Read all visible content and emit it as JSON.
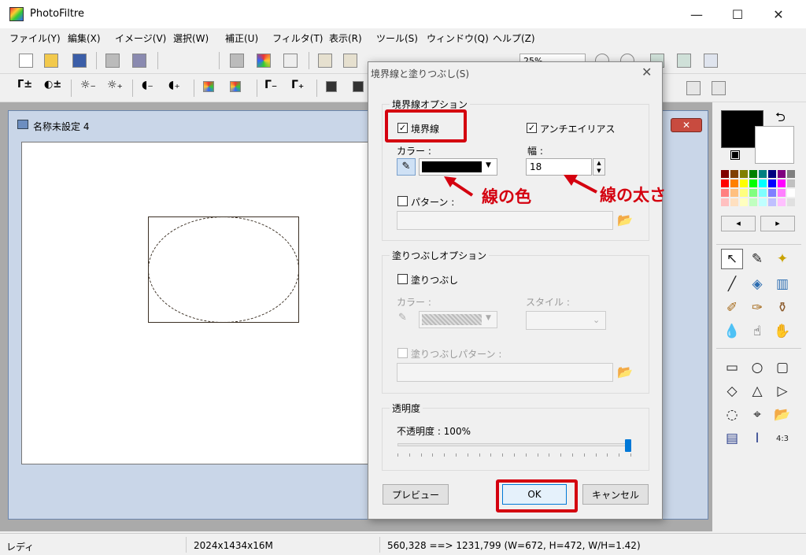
{
  "app": {
    "title": "PhotoFiltre"
  },
  "window_controls": {
    "minimize": "—",
    "maximize": "☐",
    "close": "✕"
  },
  "menu": [
    "ファイル(Y)",
    "編集(X)",
    "イメージ(V)",
    "選択(W)",
    "補正(U)",
    "フィルタ(T)",
    "表示(R)",
    "ツール(S)",
    "ウィンドウ(Q)",
    "ヘルプ(Z)"
  ],
  "toolbar": {
    "zoom_value": "25%"
  },
  "document": {
    "title": "名称未設定 4"
  },
  "dialog": {
    "title": "境界線と塗りつぶし(S)",
    "close": "✕",
    "border_group": {
      "label": "境界線オプション",
      "border_checkbox_label": "境界線",
      "border_checked": true,
      "antialias_label": "アンチエイリアス",
      "antialias_checked": true,
      "color_label": "カラー :",
      "color_value": "#000000",
      "width_label": "幅 :",
      "width_value": "18",
      "pattern_label": "パターン :",
      "pattern_checked": false
    },
    "fill_group": {
      "label": "塗りつぶしオプション",
      "fill_label": "塗りつぶし",
      "fill_checked": false,
      "color_label": "カラー :",
      "style_label": "スタイル :",
      "pattern_label": "塗りつぶしパターン :"
    },
    "opacity_group": {
      "label": "透明度",
      "opacity_label": "不透明度 : 100%",
      "opacity_fraction": 1.0
    },
    "buttons": {
      "preview": "プレビュー",
      "ok": "OK",
      "cancel": "キャンセル"
    }
  },
  "annotations": {
    "line_color": "線の色",
    "line_width": "線の太さ"
  },
  "status": {
    "mode": "レディ",
    "size": "2024x1434x16M",
    "coords": "560,328 ==> 1231,799 (W=672, H=472, W/H=1.42)"
  },
  "palette_colors": [
    "#800000",
    "#804000",
    "#808000",
    "#008000",
    "#008080",
    "#000080",
    "#800080",
    "#808080",
    "#ff0000",
    "#ff8000",
    "#ffff00",
    "#00ff00",
    "#00ffff",
    "#0000ff",
    "#ff00ff",
    "#c0c0c0",
    "#ff8080",
    "#ffc080",
    "#ffff80",
    "#80ff80",
    "#80ffff",
    "#8080ff",
    "#ff80ff",
    "#ffffff",
    "#ffc0c0",
    "#ffe0c0",
    "#ffffc0",
    "#c0ffc0",
    "#c0ffff",
    "#c0c0ff",
    "#ffc0ff",
    "#e0e0e0"
  ],
  "accent": {
    "red": "#d4000f"
  }
}
